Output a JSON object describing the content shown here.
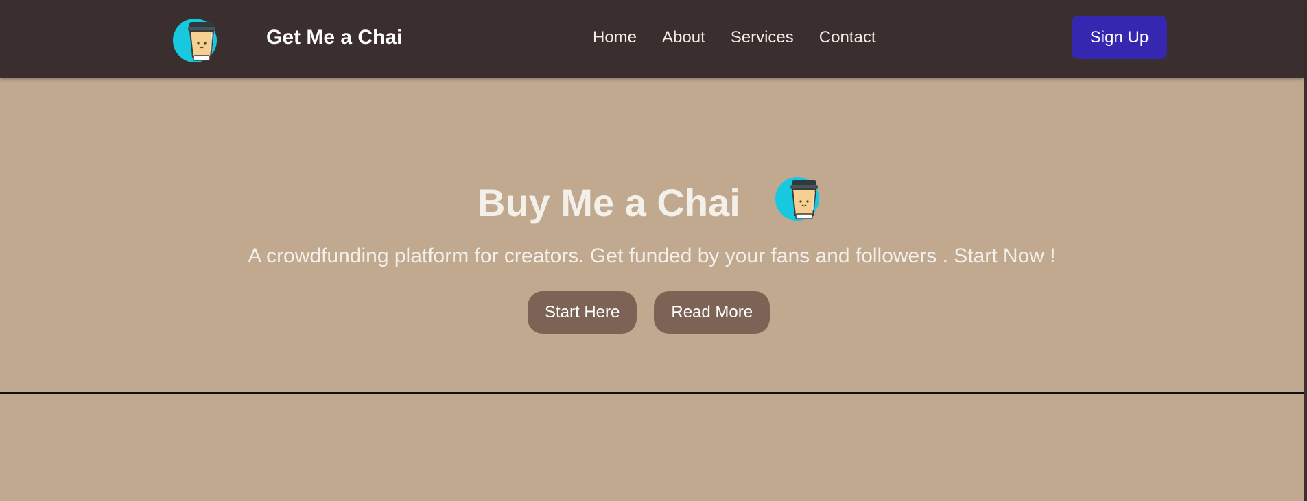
{
  "navbar": {
    "brand_name": "Get Me a Chai",
    "links": [
      {
        "label": "Home"
      },
      {
        "label": "About"
      },
      {
        "label": "Services"
      },
      {
        "label": "Contact"
      }
    ],
    "signup_label": "Sign Up",
    "logo_icon": "chai-cup-icon"
  },
  "hero": {
    "title": "Buy Me a Chai",
    "subtitle": "A crowdfunding platform for creators. Get funded by your fans and followers . Start Now !",
    "buttons": [
      {
        "label": "Start Here"
      },
      {
        "label": "Read More"
      }
    ],
    "logo_icon": "chai-cup-icon"
  },
  "colors": {
    "navbar_bg": "#3a2e2f",
    "page_bg": "#c1a990",
    "signup_bg": "#3627b0",
    "hero_button_bg": "#7d6355",
    "logo_circle": "#17c9de",
    "cup_body": "#f6cf92"
  }
}
